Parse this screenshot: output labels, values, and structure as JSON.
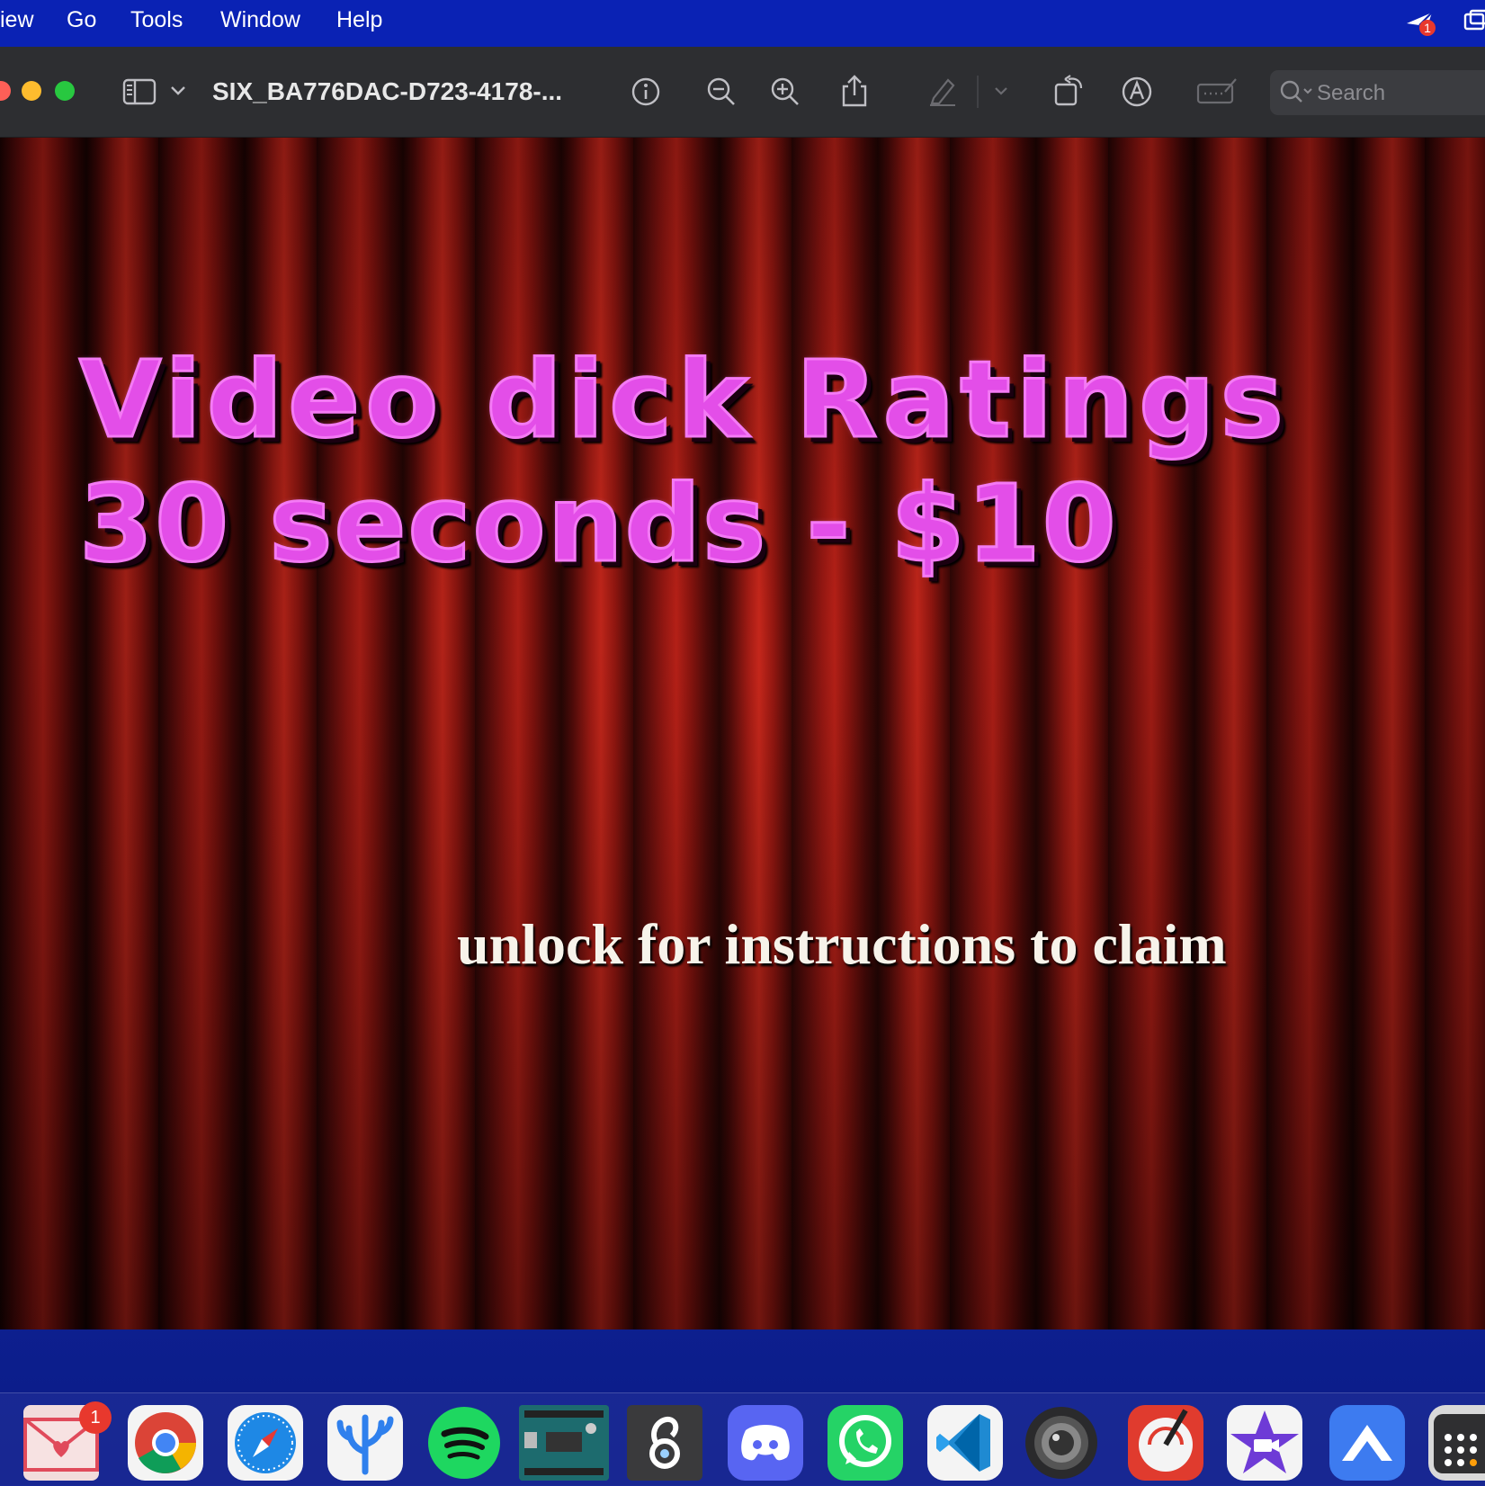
{
  "menubar": {
    "items": [
      "iew",
      "Go",
      "Tools",
      "Window",
      "Help"
    ],
    "notification_badge": "1"
  },
  "window": {
    "title": "SIX_BA776DAC-D723-4178-...",
    "search_placeholder": "Search"
  },
  "document": {
    "headline_line1": "Video dick Ratings",
    "headline_line2": "30 seconds - $10",
    "caption": "unlock for instructions to claim"
  },
  "dock": {
    "apps": [
      "mail",
      "chrome",
      "safari",
      "vscodium",
      "spotify",
      "arduino",
      "ollama",
      "discord",
      "whatsapp",
      "vscode",
      "camera",
      "pixelmator",
      "imovie",
      "vpn",
      "calculator"
    ],
    "mail_badge": "1"
  },
  "colors": {
    "menubar": "#0a22b4",
    "toolbar": "#2d2e31",
    "headline": "#e34ee8",
    "caption": "#f7f3ea",
    "curtain": "#b21e16"
  }
}
